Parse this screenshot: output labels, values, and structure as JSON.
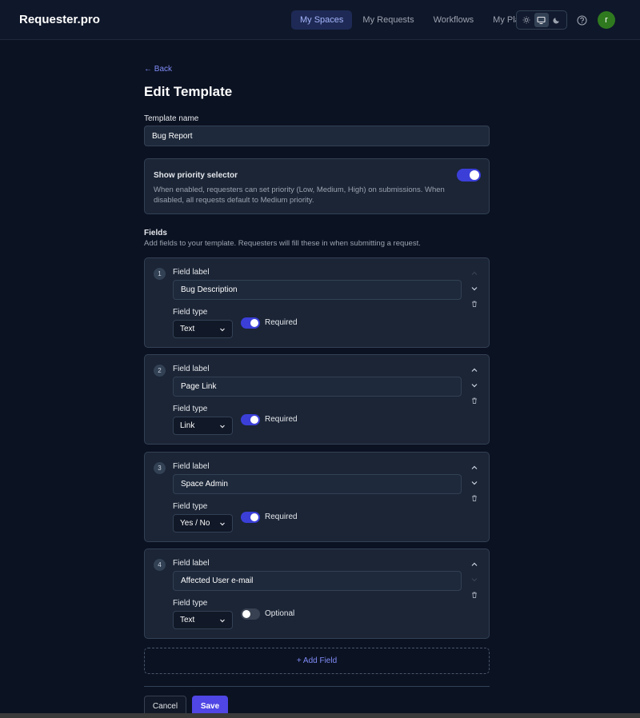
{
  "app": {
    "brand": "Requester.pro"
  },
  "nav": {
    "items": [
      {
        "label": "My Spaces",
        "active": true
      },
      {
        "label": "My Requests",
        "active": false
      },
      {
        "label": "Workflows",
        "active": false
      },
      {
        "label": "My Plan",
        "active": false
      }
    ],
    "theme": {
      "options": [
        "sun-icon",
        "monitor-icon",
        "moon-icon"
      ],
      "selected": "monitor-icon"
    },
    "avatar_initial": "r"
  },
  "page": {
    "back_label": "← Back",
    "title": "Edit Template",
    "template_name_label": "Template name",
    "template_name_value": "Bug Report"
  },
  "priority": {
    "title": "Show priority selector",
    "description": "When enabled, requesters can set priority (Low, Medium, High) on submissions. When disabled, all requests default to Medium priority.",
    "enabled": true
  },
  "fields_section": {
    "heading": "Fields",
    "subheading": "Add fields to your template. Requesters will fill these in when submitting a request.",
    "field_label_caption": "Field label",
    "field_type_caption": "Field type",
    "fields": [
      {
        "number": "1",
        "label": "Bug Description",
        "type": "Text",
        "required": true,
        "required_label": "Required"
      },
      {
        "number": "2",
        "label": "Page Link",
        "type": "Link",
        "required": true,
        "required_label": "Required"
      },
      {
        "number": "3",
        "label": "Space Admin",
        "type": "Yes / No",
        "required": true,
        "required_label": "Required"
      },
      {
        "number": "4",
        "label": "Affected User e-mail",
        "type": "Text",
        "required": false,
        "required_label": "Optional"
      }
    ]
  },
  "actions": {
    "add_field": "+ Add Field",
    "cancel": "Cancel",
    "save": "Save"
  },
  "colors": {
    "background": "#0b1222",
    "accent": "#4f46e5",
    "link": "#818cf8",
    "avatar": "#2f7a1f"
  }
}
